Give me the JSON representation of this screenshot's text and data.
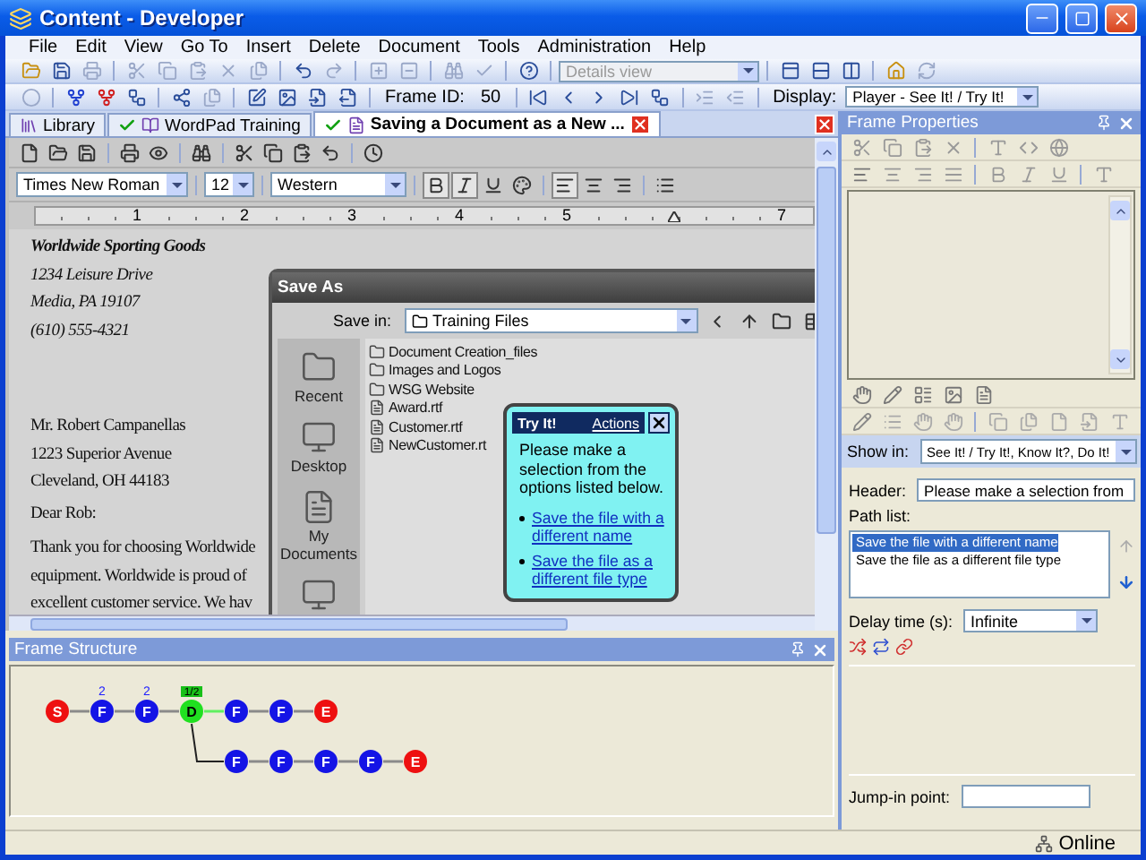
{
  "window": {
    "title": "Content - Developer"
  },
  "menu": [
    "File",
    "Edit",
    "View",
    "Go To",
    "Insert",
    "Delete",
    "Document",
    "Tools",
    "Administration",
    "Help"
  ],
  "toolbar": {
    "view_select": {
      "value": "Details view",
      "disabled": true
    },
    "frame_id_label": "Frame ID:",
    "frame_id": "50",
    "display_label": "Display:",
    "display_value": "Player - See It! / Try It!"
  },
  "tabs": [
    {
      "kind": "library",
      "label": "Library",
      "checked": false,
      "selected": false
    },
    {
      "kind": "outline",
      "label": "WordPad Training",
      "checked": true,
      "selected": false
    },
    {
      "kind": "topic",
      "label": "Saving a Document as a New ...",
      "checked": true,
      "selected": true
    }
  ],
  "frame_screenshot": {
    "font": "Times New Roman",
    "size": "12",
    "script": "Western",
    "ruler": [
      {
        "kind": "number",
        "label": "1"
      },
      {
        "kind": "number",
        "label": "2"
      },
      {
        "kind": "number",
        "label": "3"
      },
      {
        "kind": "number",
        "label": "4"
      },
      {
        "kind": "number",
        "label": "5"
      },
      {
        "kind": "indent"
      },
      {
        "kind": "number",
        "label": "7"
      }
    ],
    "letterhead": [
      "Worldwide Sporting Goods",
      "1234 Leisure Drive",
      "Media, PA 19107",
      "(610) 555-4321"
    ],
    "address": [
      "Mr. Robert Campanellas",
      "1223 Superior Avenue",
      "Cleveland, OH  44183"
    ],
    "greeting": "Dear Rob:",
    "body": [
      "Thank you for choosing Worldwide",
      "equipment. Worldwide is proud of",
      "excellent customer service.  We hav"
    ],
    "save_as": {
      "title": "Save As",
      "save_in_label": "Save in:",
      "save_in": "Training Files",
      "places": [
        {
          "kind": "recent",
          "label": "Recent"
        },
        {
          "kind": "desktop",
          "label": "Desktop"
        },
        {
          "kind": "documents",
          "label": "My Documents"
        },
        {
          "kind": "computer"
        }
      ],
      "files": [
        {
          "kind": "folder",
          "name": "Document Creation_files"
        },
        {
          "kind": "folder",
          "name": "Images and Logos"
        },
        {
          "kind": "folder",
          "name": "WSG Website"
        },
        {
          "kind": "file",
          "name": "Award.rtf"
        },
        {
          "kind": "file",
          "name": "Customer.rtf"
        },
        {
          "kind": "file",
          "name": "NewCustomer.rt"
        }
      ]
    },
    "bubble": {
      "title": "Try It!",
      "actions": "Actions",
      "message": "Please make a selection from the options listed below.",
      "options": [
        "Save the file with a different name",
        "Save the file as a different file type"
      ]
    }
  },
  "frame_structure": {
    "title": "Frame Structure",
    "nodes": [
      {
        "kind": "start",
        "label": "S"
      },
      {
        "kind": "frame",
        "label": "F",
        "badge": "2"
      },
      {
        "kind": "frame",
        "label": "F",
        "badge": "2"
      },
      {
        "kind": "decision",
        "label": "D",
        "badge": "1/2",
        "children": [
          {
            "kind": "frame",
            "label": "F"
          },
          {
            "kind": "frame",
            "label": "F"
          },
          {
            "kind": "frame",
            "label": "F"
          },
          {
            "kind": "frame",
            "label": "F"
          },
          {
            "kind": "end",
            "label": "E"
          }
        ]
      },
      {
        "kind": "frame",
        "label": "F"
      },
      {
        "kind": "frame",
        "label": "F"
      },
      {
        "kind": "end",
        "label": "E"
      }
    ]
  },
  "frame_properties": {
    "title": "Frame Properties",
    "show_in_label": "Show in:",
    "show_in": "See It! / Try It!, Know It?, Do It!",
    "header_label": "Header:",
    "header": "Please make a selection from",
    "path_list_label": "Path list:",
    "paths": [
      {
        "label": "Save the file with a different name",
        "selected": true
      },
      {
        "label": "Save the file as a different file type",
        "selected": false
      }
    ],
    "delay_label": "Delay time (s):",
    "delay": "Infinite",
    "jump_in_label": "Jump-in point:"
  },
  "status_bar": {
    "text": "Online"
  }
}
